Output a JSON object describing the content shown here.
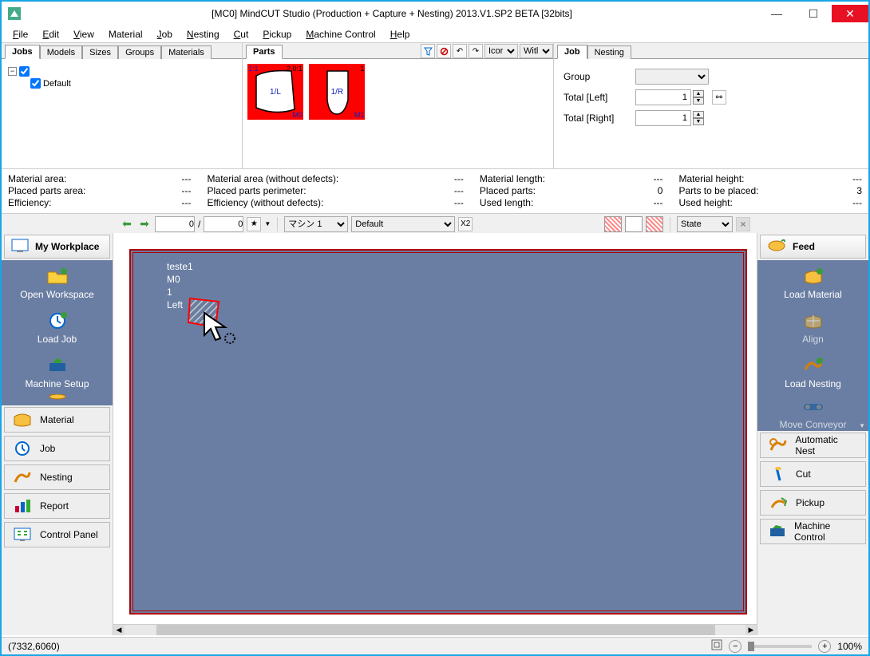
{
  "title": "[MC0] MindCUT Studio (Production + Capture + Nesting) 2013.V1.SP2  BETA [32bits]",
  "menubar": [
    "File",
    "Edit",
    "View",
    "Material",
    "Job",
    "Nesting",
    "Cut",
    "Pickup",
    "Machine Control",
    "Help"
  ],
  "leftTabs": [
    "Jobs",
    "Models",
    "Sizes",
    "Groups",
    "Materials"
  ],
  "tree": {
    "root": "",
    "default": "Default"
  },
  "partsTab": "Parts",
  "partsToolbar": {
    "icor": "Icor",
    "witl": "Witl"
  },
  "parts": [
    {
      "topLeft": "1:1",
      "topRight": "2 0:1",
      "bottomRight": "M0",
      "label": "1/L"
    },
    {
      "topLeft": "",
      "topRight": "1",
      "bottomRight": "M1",
      "label": "1/R"
    }
  ],
  "rightTabs": [
    "Job",
    "Nesting"
  ],
  "props": {
    "groupLabel": "Group",
    "totalLeftLabel": "Total [Left]",
    "totalRightLabel": "Total [Right]",
    "groupValue": "",
    "totalLeft": "1",
    "totalRight": "1"
  },
  "stats": {
    "materialArea": "Material area:",
    "placedPartsArea": "Placed parts area:",
    "efficiency": "Efficiency:",
    "materialAreaWD": "Material area (without defects):",
    "placedPartsPerim": "Placed parts perimeter:",
    "efficiencyWD": "Efficiency (without defects):",
    "materialLength": "Material length:",
    "placedParts": "Placed parts:",
    "usedLength": "Used length:",
    "materialHeight": "Material height:",
    "partsToBePlaced": "Parts to be placed:",
    "usedHeight": "Used height:",
    "dash": "---",
    "zero": "0",
    "three": "3"
  },
  "toolrow": {
    "page1": "0",
    "page2": "0",
    "slash": "/",
    "machine": "マシン 1",
    "layer": "Default",
    "multiplier": "X2",
    "state": "State"
  },
  "leftbar": {
    "header": "My Workplace",
    "openWorkspace": "Open Workspace",
    "loadJob": "Load Job",
    "machineSetup": "Machine Setup",
    "material": "Material",
    "job": "Job",
    "nesting": "Nesting",
    "report": "Report",
    "controlPanel": "Control Panel"
  },
  "rightbar": {
    "header": "Feed",
    "loadMaterial": "Load Material",
    "align": "Align",
    "loadNesting": "Load Nesting",
    "moveConveyor": "Move Conveyor",
    "automaticNest": "Automatic Nest",
    "cut": "Cut",
    "pickup": "Pickup",
    "machineControl": "Machine Control"
  },
  "piece": {
    "l1": "teste1",
    "l2": "M0",
    "l3": "1",
    "l4": "Left"
  },
  "statusbar": {
    "coords": "(7332,6060)",
    "zoom": "100%"
  }
}
